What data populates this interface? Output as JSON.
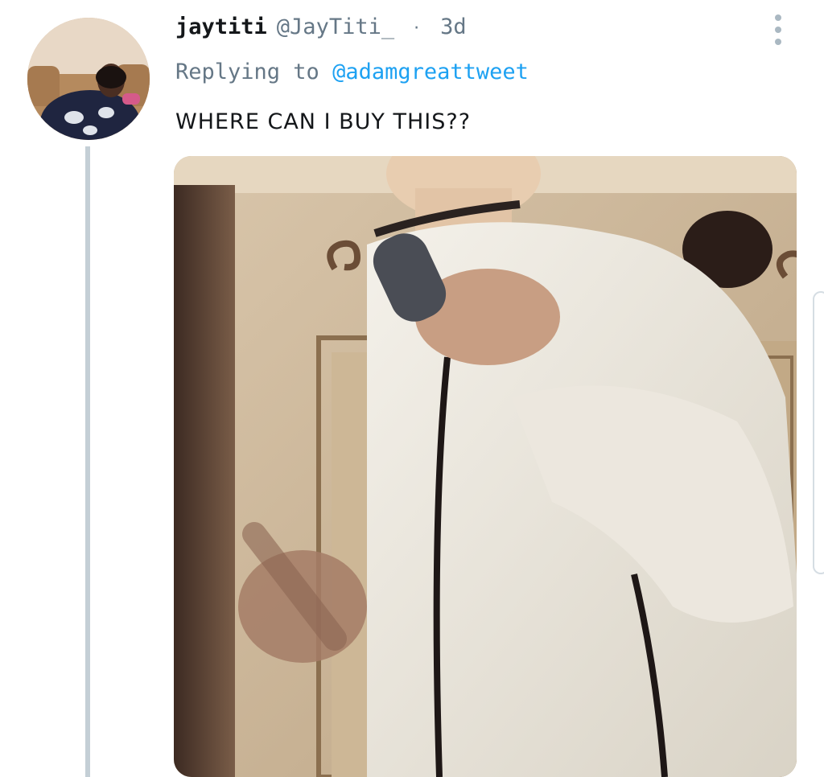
{
  "tweet": {
    "display_name": "jaytiti",
    "handle": "@JayTiti_",
    "separator": "·",
    "time": "3d",
    "replying_prefix": "Replying to ",
    "replying_to": "@adamgreattweet",
    "text": "WHERE CAN I BUY THIS??"
  },
  "icons": {
    "more": "more-vertical-icon"
  },
  "colors": {
    "link": "#1da1f2",
    "secondary_text": "#657786",
    "thread_line": "#c4cfd6"
  }
}
